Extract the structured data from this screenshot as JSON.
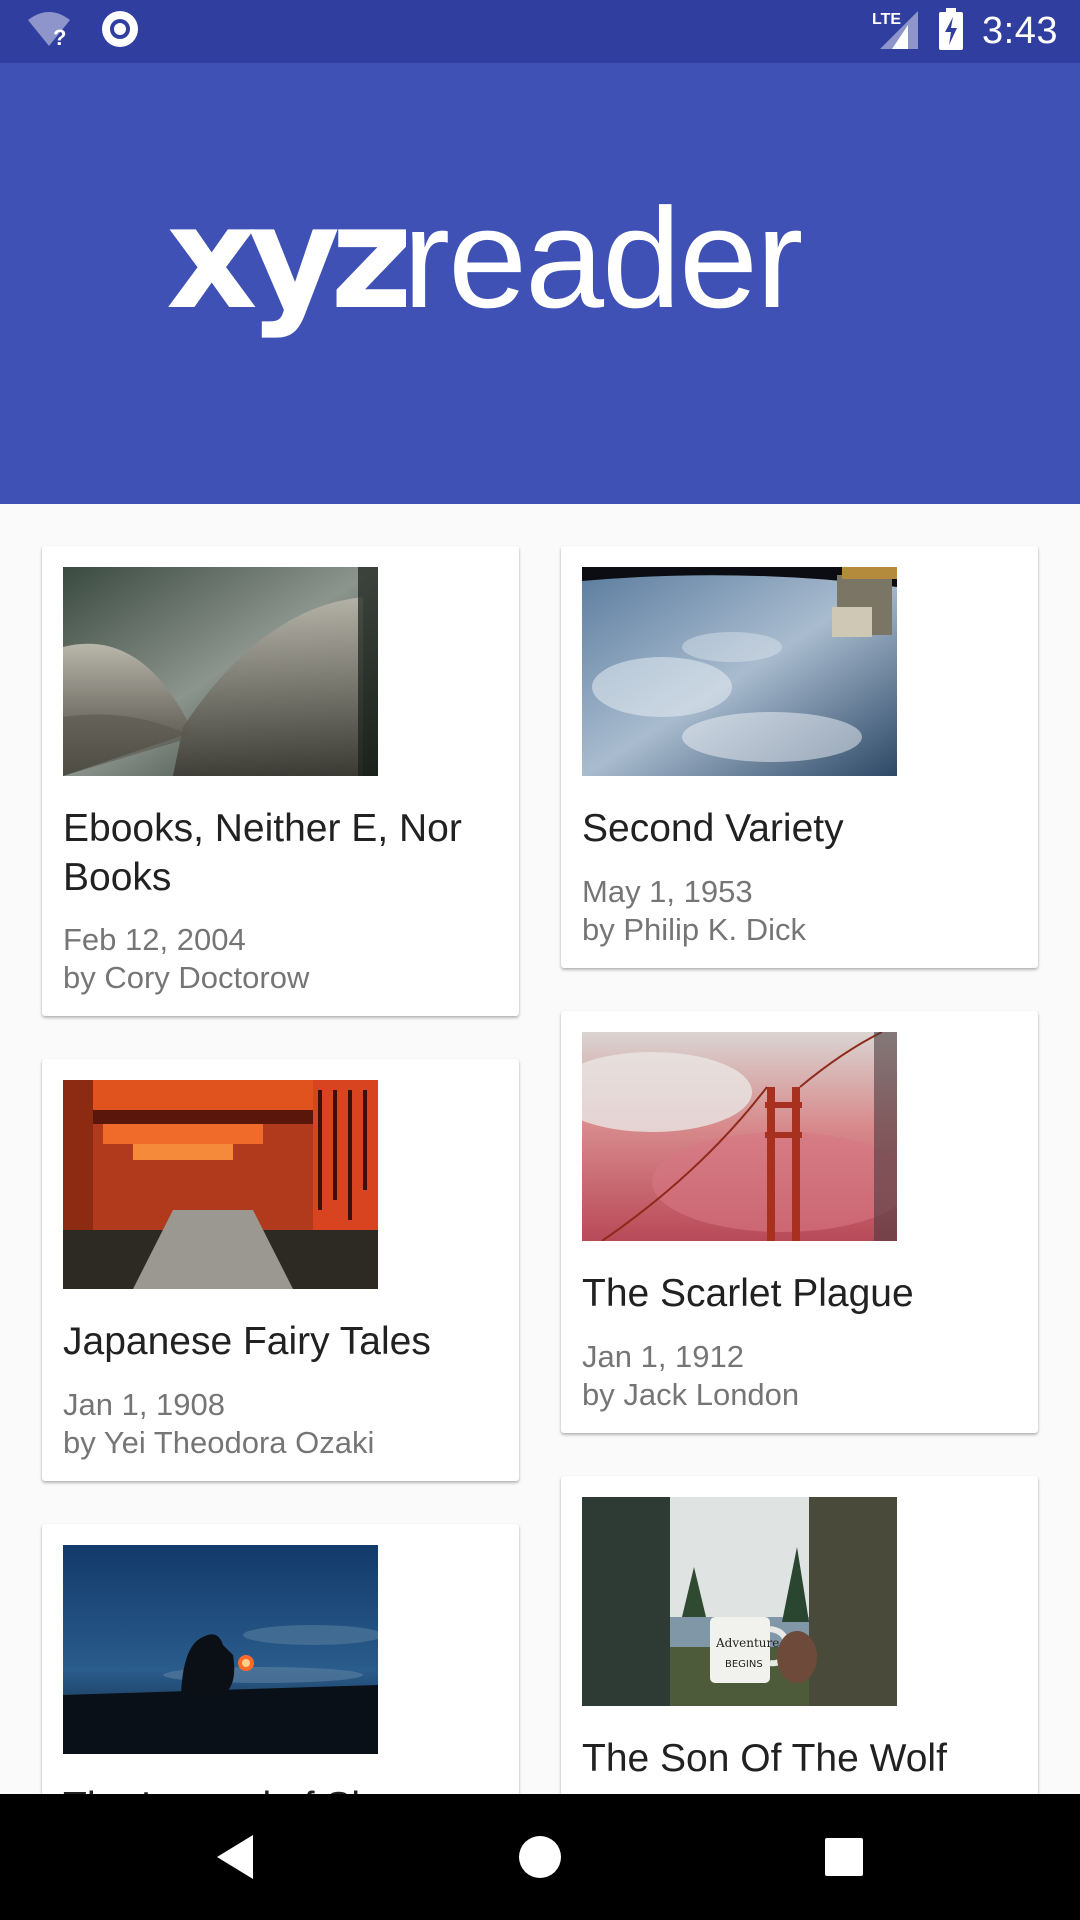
{
  "status_bar": {
    "time": "3:43",
    "network_label": "LTE",
    "icons": [
      "wifi-unknown-icon",
      "sync-icon",
      "lte-signal-icon",
      "battery-charging-icon"
    ]
  },
  "app_bar": {
    "logo_part1": "xyz",
    "logo_part2": "reader",
    "background": "#3F51B5",
    "status_background": "#303F9F"
  },
  "articles": [
    {
      "title": "Ebooks, Neither E, Nor Books",
      "date": "Feb 12, 2004",
      "byline": "by Cory Doctorow",
      "image": "opera-house-roof-image"
    },
    {
      "title": "Second Variety",
      "date": "May 1, 1953",
      "byline": "by Philip K. Dick",
      "image": "earth-from-space-image"
    },
    {
      "title": "Japanese Fairy Tales",
      "date": "Jan 1, 1908",
      "byline": "by Yei Theodora Ozaki",
      "image": "torii-gates-image"
    },
    {
      "title": "The Scarlet Plague",
      "date": "Jan 1, 1912",
      "byline": "by Jack London",
      "image": "bridge-in-red-fog-image"
    },
    {
      "title": "The Legend of Sleepy Hollow",
      "date": "",
      "byline": "",
      "image": "lantern-at-dusk-image"
    },
    {
      "title": "The Son Of The Wolf",
      "date": "",
      "byline": "",
      "image": "adventure-mug-image"
    }
  ],
  "nav_bar": {
    "buttons": [
      "back-icon",
      "home-icon",
      "recents-icon"
    ]
  }
}
